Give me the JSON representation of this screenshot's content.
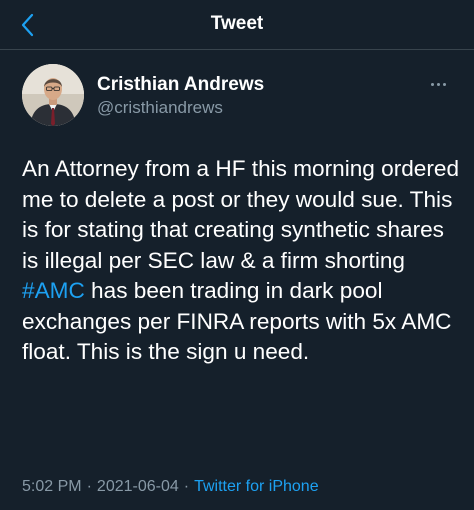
{
  "header": {
    "title": "Tweet",
    "back_icon": "chevron-left-icon"
  },
  "author": {
    "name": "Cristhian Andrews",
    "handle": "@cristhiandrews",
    "avatar_icon": "profile-photo"
  },
  "tweet": {
    "text_part1": "An Attorney from a HF this morning ordered me to delete a post or they would sue. This is for stating that creating synthetic shares is illegal per SEC law & a firm shorting ",
    "hashtag": "#AMC",
    "text_part2": " has been trading in dark pool exchanges per FINRA reports with 5x AMC float. This is the sign u need."
  },
  "meta": {
    "time": "5:02 PM",
    "separator": "·",
    "date": "2021-06-04",
    "source": "Twitter for iPhone"
  },
  "colors": {
    "background": "#15202b",
    "accent": "#1da1f2",
    "secondary_text": "#8899a6",
    "divider": "#38444d"
  }
}
